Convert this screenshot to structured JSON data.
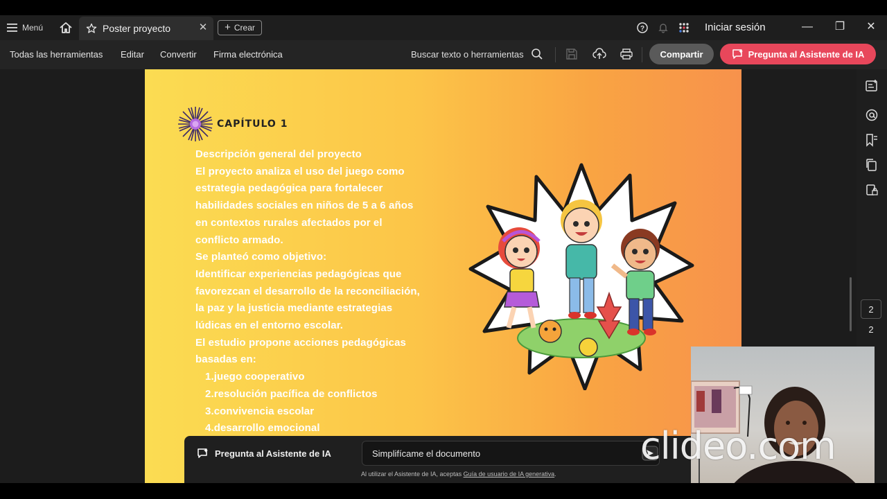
{
  "titlebar": {
    "menu_label": "Menú",
    "tab_title": "Poster proyecto",
    "create_label": "Crear",
    "signin_label": "Iniciar sesión"
  },
  "toolbar": {
    "items": [
      "Todas las herramientas",
      "Editar",
      "Convertir",
      "Firma electrónica"
    ],
    "search_label": "Buscar texto o herramientas",
    "share_label": "Compartir",
    "ai_label": "Pregunta al Asistente de IA"
  },
  "poster": {
    "chapter": "CAPÍTULO 1",
    "lines": [
      "Descripción general del proyecto",
      "El proyecto analiza el uso del juego como",
      "estrategia pedagógica para fortalecer",
      "habilidades sociales en niños de 5 a 6 años",
      "en contextos rurales afectados por el",
      "conflicto armado.",
      "Se planteó como objetivo:",
      "Identificar experiencias pedagógicas que",
      "favorezcan el desarrollo de la reconciliación,",
      "la paz y la justicia mediante estrategias",
      "lúdicas en el entorno escolar.",
      "El estudio propone acciones pedagógicas",
      "basadas en:"
    ],
    "list": [
      "1.juego cooperativo",
      "2.resolución pacífica de conflictos",
      "3.convivencia escolar",
      "4.desarrollo emocional"
    ]
  },
  "pager": {
    "current": "2",
    "total": "2"
  },
  "ai_panel": {
    "label": "Pregunta al Asistente de IA",
    "input_value": "Simplifícame el documento",
    "legal_prefix": "Al utilizar el Asistente de IA, aceptas ",
    "legal_link": "Guía de usuario de IA generativa",
    "legal_suffix": "."
  },
  "watermark": "clideo.com",
  "colors": {
    "accent_ai": "#e8475b",
    "poster_start": "#fbdc52",
    "poster_end": "#f7924c"
  }
}
